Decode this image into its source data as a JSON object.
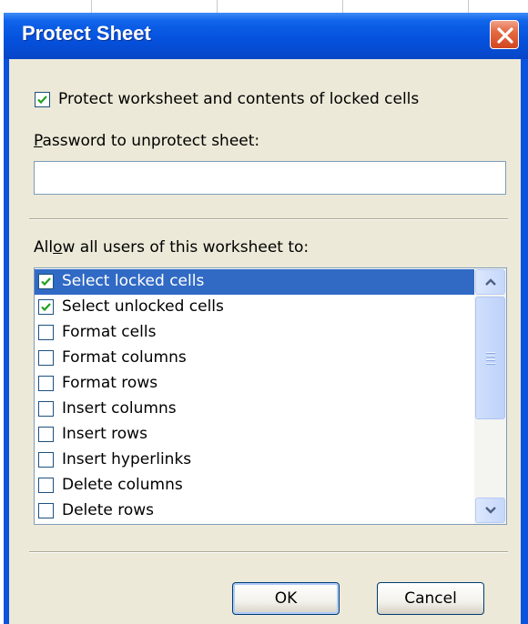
{
  "dialog": {
    "title": "Protect Sheet",
    "close_icon": "close-icon"
  },
  "protect_checkbox": {
    "checked": true,
    "label": "Protect worksheet and contents of locked cells"
  },
  "password": {
    "label_prefix": "",
    "label_accel": "P",
    "label_rest": "assword to unprotect sheet:",
    "value": ""
  },
  "permissions": {
    "label_prefix": "All",
    "label_accel": "o",
    "label_rest": "w all users of this worksheet to:",
    "items": [
      {
        "label": "Select locked cells",
        "checked": true,
        "selected": true
      },
      {
        "label": "Select unlocked cells",
        "checked": true,
        "selected": false
      },
      {
        "label": "Format cells",
        "checked": false,
        "selected": false
      },
      {
        "label": "Format columns",
        "checked": false,
        "selected": false
      },
      {
        "label": "Format rows",
        "checked": false,
        "selected": false
      },
      {
        "label": "Insert columns",
        "checked": false,
        "selected": false
      },
      {
        "label": "Insert rows",
        "checked": false,
        "selected": false
      },
      {
        "label": "Insert hyperlinks",
        "checked": false,
        "selected": false
      },
      {
        "label": "Delete columns",
        "checked": false,
        "selected": false
      },
      {
        "label": "Delete rows",
        "checked": false,
        "selected": false
      }
    ]
  },
  "buttons": {
    "ok": "OK",
    "cancel": "Cancel"
  },
  "colors": {
    "titlebar": "#0552de",
    "selection": "#316ac5",
    "face": "#ece9d8",
    "check": "#21a121"
  }
}
